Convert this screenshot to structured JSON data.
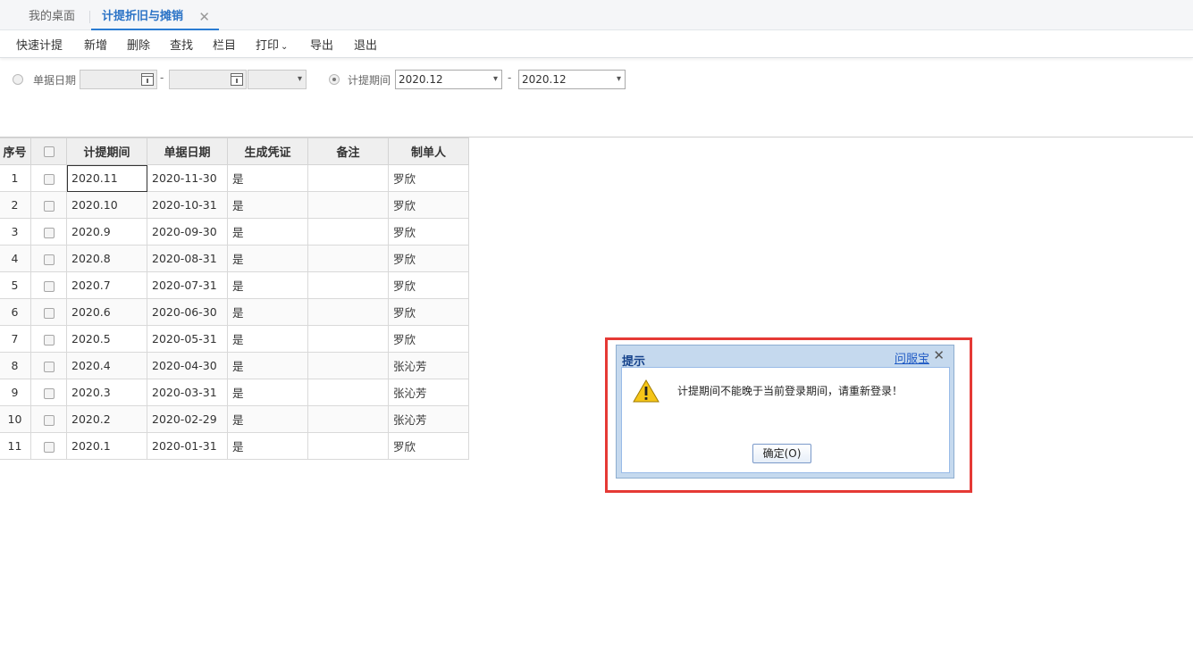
{
  "tabs": {
    "home": "我的桌面",
    "active": "计提折旧与摊销",
    "close_glyph": "✕"
  },
  "toolbar": {
    "quick": "快速计提",
    "add": "新增",
    "delete": "删除",
    "find": "查找",
    "columns": "栏目",
    "print": "打印",
    "print_caret": "⌄",
    "export": "导出",
    "exit": "退出"
  },
  "filters": {
    "doc_date_label": "单据日期",
    "dash": "-",
    "period_label": "计提期间",
    "period_from": "2020.12",
    "period_to": "2020.12",
    "arrow": "▾"
  },
  "table": {
    "headers": [
      "序号",
      "",
      "计提期间",
      "单据日期",
      "生成凭证",
      "备注",
      "制单人"
    ],
    "rows": [
      {
        "no": "1",
        "period": "2020.11",
        "date": "2020-11-30",
        "voucher": "是",
        "note": "",
        "maker": "罗欣"
      },
      {
        "no": "2",
        "period": "2020.10",
        "date": "2020-10-31",
        "voucher": "是",
        "note": "",
        "maker": "罗欣"
      },
      {
        "no": "3",
        "period": "2020.9",
        "date": "2020-09-30",
        "voucher": "是",
        "note": "",
        "maker": "罗欣"
      },
      {
        "no": "4",
        "period": "2020.8",
        "date": "2020-08-31",
        "voucher": "是",
        "note": "",
        "maker": "罗欣"
      },
      {
        "no": "5",
        "period": "2020.7",
        "date": "2020-07-31",
        "voucher": "是",
        "note": "",
        "maker": "罗欣"
      },
      {
        "no": "6",
        "period": "2020.6",
        "date": "2020-06-30",
        "voucher": "是",
        "note": "",
        "maker": "罗欣"
      },
      {
        "no": "7",
        "period": "2020.5",
        "date": "2020-05-31",
        "voucher": "是",
        "note": "",
        "maker": "罗欣"
      },
      {
        "no": "8",
        "period": "2020.4",
        "date": "2020-04-30",
        "voucher": "是",
        "note": "",
        "maker": "张沁芳"
      },
      {
        "no": "9",
        "period": "2020.3",
        "date": "2020-03-31",
        "voucher": "是",
        "note": "",
        "maker": "张沁芳"
      },
      {
        "no": "10",
        "period": "2020.2",
        "date": "2020-02-29",
        "voucher": "是",
        "note": "",
        "maker": "张沁芳"
      },
      {
        "no": "11",
        "period": "2020.1",
        "date": "2020-01-31",
        "voucher": "是",
        "note": "",
        "maker": "罗欣"
      }
    ]
  },
  "dialog": {
    "title": "提示",
    "help_link": "问服宝",
    "close_glyph": "✕",
    "message": "计提期间不能晚于当前登录期间，请重新登录！",
    "ok_label": "确定(O)"
  }
}
